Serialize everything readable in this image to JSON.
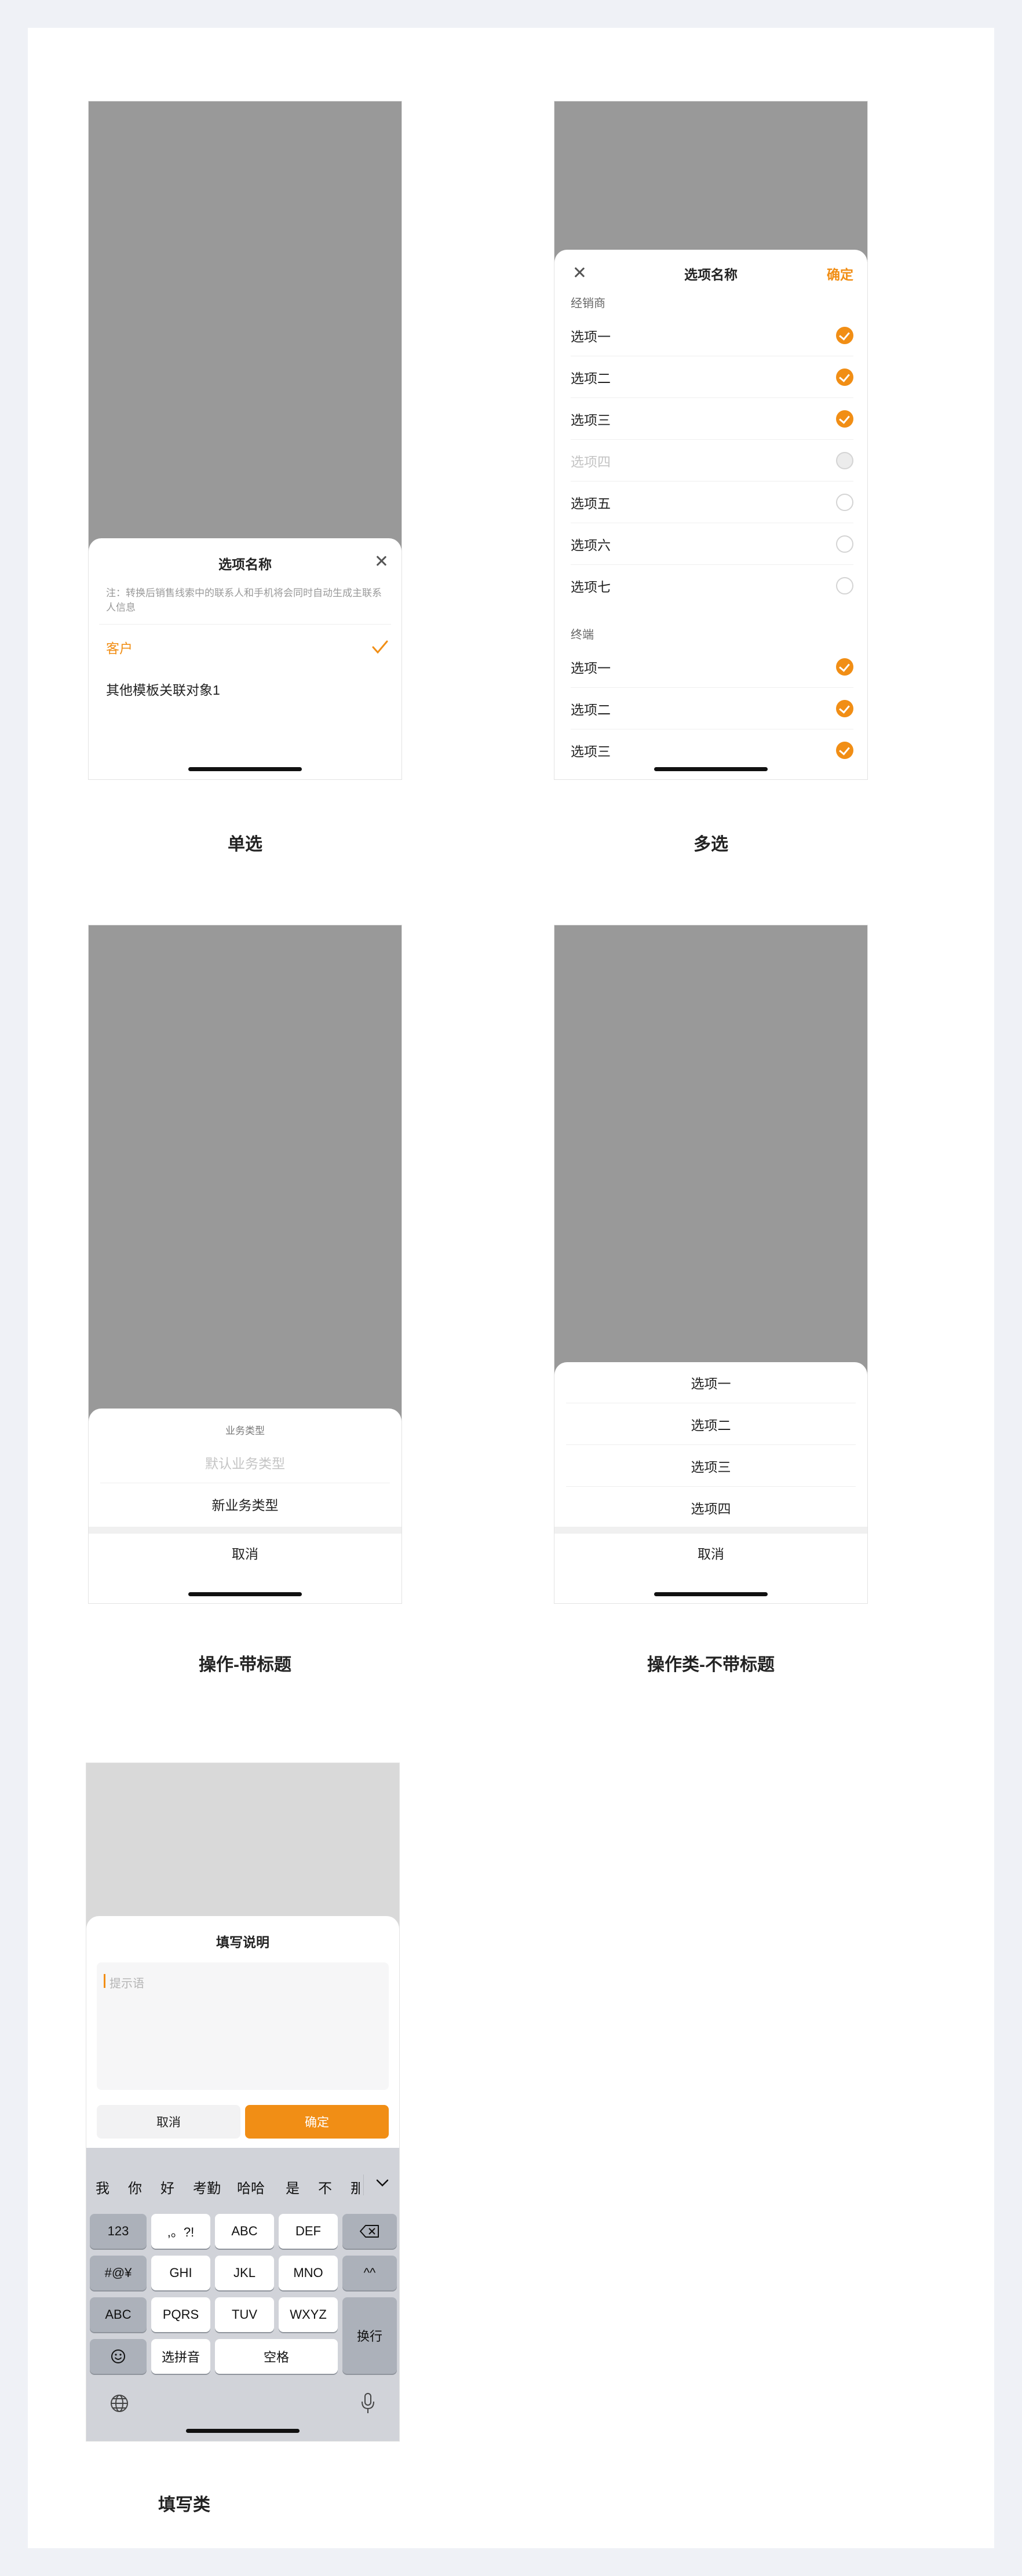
{
  "single": {
    "caption": "单选",
    "title": "选项名称",
    "note": "注：转换后销售线索中的联系人和手机将会同时自动生成主联系人信息",
    "options": [
      {
        "label": "客户",
        "selected": true
      },
      {
        "label": "其他模板关联对象1",
        "selected": false
      }
    ]
  },
  "multi": {
    "caption": "多选",
    "title": "选项名称",
    "confirm": "确定",
    "groups": [
      {
        "label": "经销商",
        "items": [
          {
            "label": "选项一",
            "state": "checked"
          },
          {
            "label": "选项二",
            "state": "checked"
          },
          {
            "label": "选项三",
            "state": "checked"
          },
          {
            "label": "选项四",
            "state": "disabled"
          },
          {
            "label": "选项五",
            "state": "unchecked"
          },
          {
            "label": "选项六",
            "state": "unchecked"
          },
          {
            "label": "选项七",
            "state": "unchecked"
          }
        ]
      },
      {
        "label": "终端",
        "items": [
          {
            "label": "选项一",
            "state": "checked"
          },
          {
            "label": "选项二",
            "state": "checked"
          },
          {
            "label": "选项三",
            "state": "checked"
          }
        ]
      }
    ]
  },
  "action_titled": {
    "caption": "操作-带标题",
    "title": "业务类型",
    "options": [
      {
        "label": "默认业务类型",
        "disabled": true
      },
      {
        "label": "新业务类型",
        "disabled": false
      }
    ],
    "cancel": "取消"
  },
  "action_untitled": {
    "caption": "操作类-不带标题",
    "options": [
      "选项一",
      "选项二",
      "选项三",
      "选项四"
    ],
    "cancel": "取消"
  },
  "fill": {
    "caption": "填写类",
    "title": "填写说明",
    "placeholder": "提示语",
    "cancel": "取消",
    "confirm": "确定",
    "candidates": [
      "我",
      "你",
      "好",
      "考勤",
      "哈哈",
      "是",
      "不",
      "那"
    ],
    "keys": {
      "num": "123",
      "punct": ",。?!",
      "abc": "ABC",
      "def": "DEF",
      "sym": "#@¥",
      "ghi": "GHI",
      "jkl": "JKL",
      "mno": "MNO",
      "face": "^^",
      "abc_switch": "ABC",
      "pqrs": "PQRS",
      "tuv": "TUV",
      "wxyz": "WXYZ",
      "newline": "换行",
      "pinyin": "选拼音",
      "space": "空格"
    }
  },
  "colors": {
    "accent": "#f18e15",
    "backdrop": "#999999",
    "backdrop_light": "#d9d9d9",
    "keyboard": "#d1d3d9"
  }
}
